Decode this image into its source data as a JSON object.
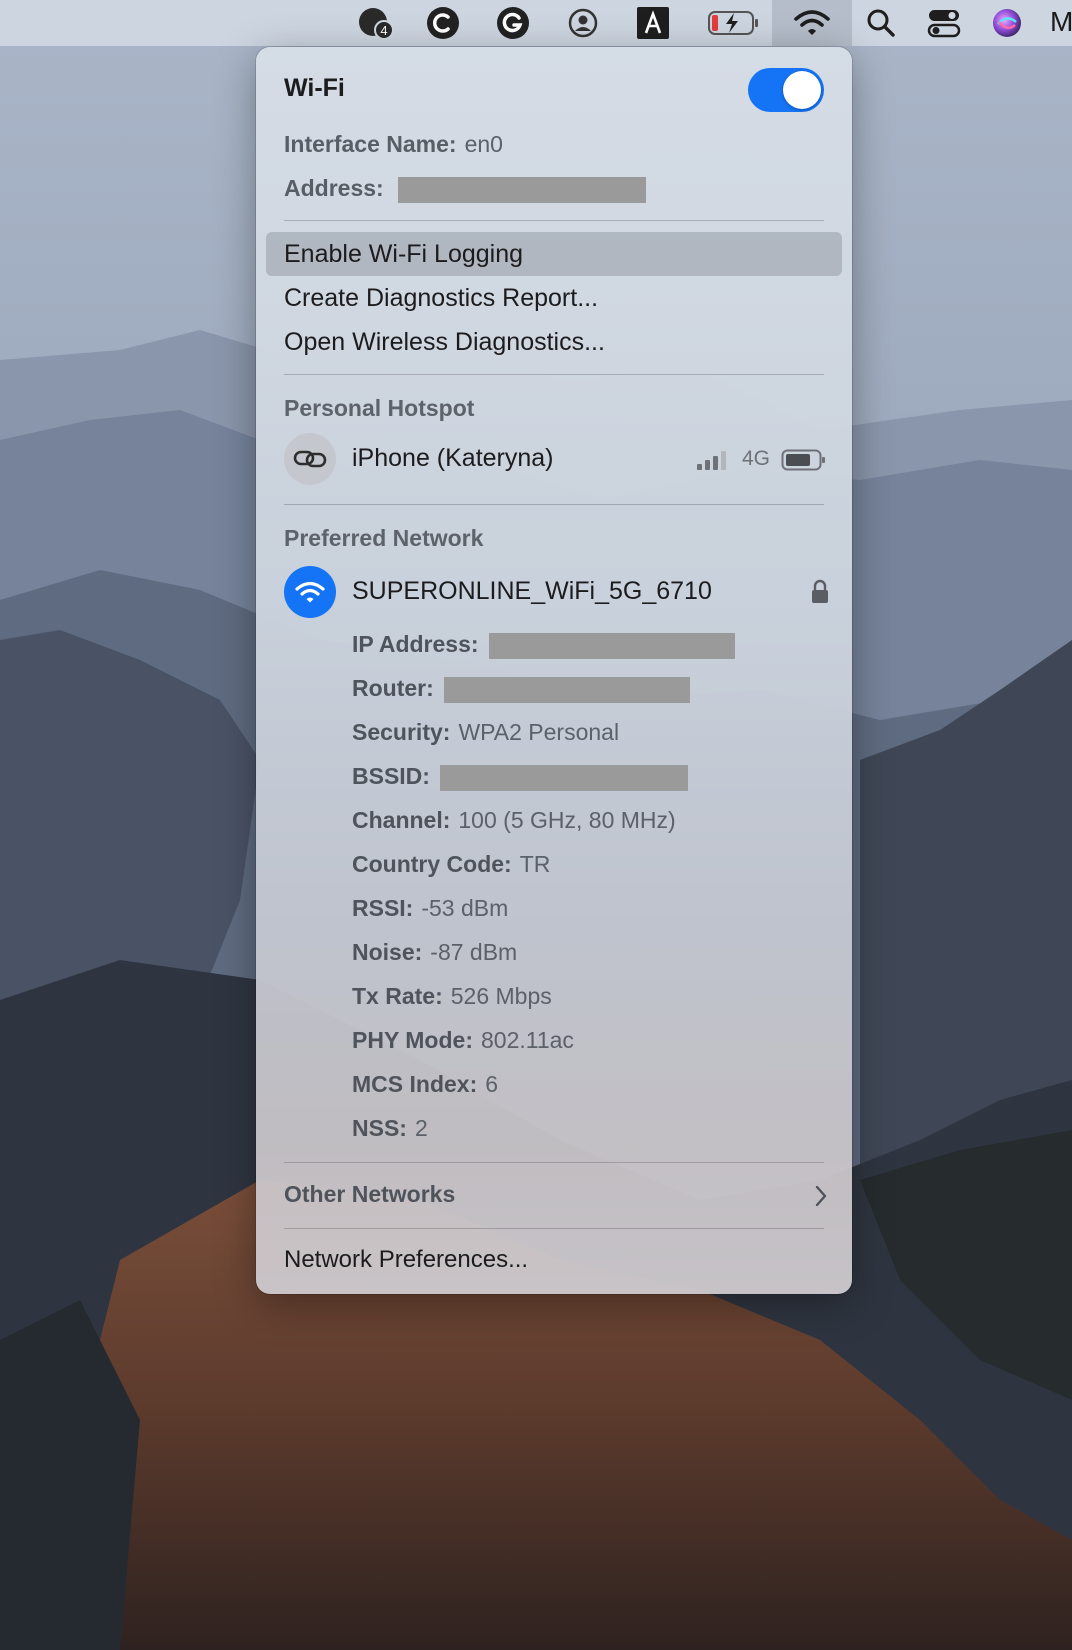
{
  "menubar": {
    "icons": [
      "badge-app-icon",
      "c-circle-icon",
      "grammarly-icon",
      "user-circle-icon",
      "text-a-icon",
      "battery-charging-icon",
      "wifi-icon",
      "search-icon",
      "control-center-icon",
      "siri-icon"
    ],
    "badge_count": "4",
    "trailing_letter": "M"
  },
  "wifi": {
    "title": "Wi-Fi",
    "enabled": true,
    "interface_label": "Interface Name:",
    "interface_value": "en0",
    "address_label": "Address:",
    "address_value": "[redacted]"
  },
  "actions": [
    {
      "label": "Enable Wi-Fi Logging",
      "highlighted": true
    },
    {
      "label": "Create Diagnostics Report..."
    },
    {
      "label": "Open Wireless Diagnostics..."
    }
  ],
  "hotspot": {
    "heading": "Personal Hotspot",
    "device": "iPhone (Kateryna)",
    "network_type": "4G",
    "icon": "link-icon"
  },
  "preferred": {
    "heading": "Preferred Network",
    "ssid": "SUPERONLINE_WiFi_5G_6710",
    "icon": "wifi-icon",
    "lock_icon": "lock-icon",
    "details": [
      {
        "label": "IP Address:",
        "value": "",
        "redacted": true
      },
      {
        "label": "Router:",
        "value": "",
        "redacted": true
      },
      {
        "label": "Security:",
        "value": "WPA2 Personal"
      },
      {
        "label": "BSSID:",
        "value": "",
        "redacted": true
      },
      {
        "label": "Channel:",
        "value": "100 (5 GHz, 80 MHz)"
      },
      {
        "label": "Country Code:",
        "value": "TR"
      },
      {
        "label": "RSSI:",
        "value": "-53 dBm"
      },
      {
        "label": "Noise:",
        "value": "-87 dBm"
      },
      {
        "label": "Tx Rate:",
        "value": "526 Mbps"
      },
      {
        "label": "PHY Mode:",
        "value": "802.11ac"
      },
      {
        "label": "MCS Index:",
        "value": "6"
      },
      {
        "label": "NSS:",
        "value": "2"
      }
    ]
  },
  "other_networks": {
    "label": "Other Networks",
    "icon": "chevron-right-icon"
  },
  "network_prefs": {
    "label": "Network Preferences..."
  },
  "colors": {
    "accent": "#1574f5",
    "panel": "#d6dde6",
    "menubar": "#d0d8e2"
  }
}
